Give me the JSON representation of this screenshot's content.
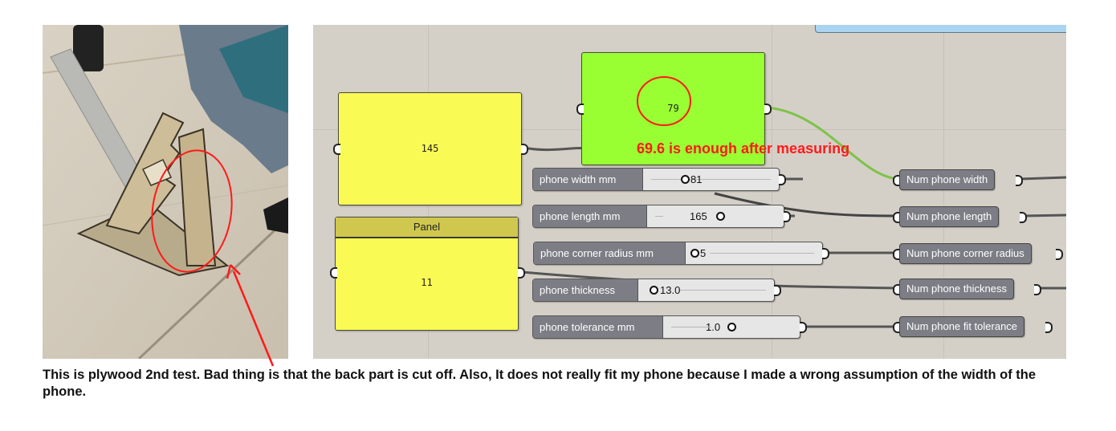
{
  "photo": {
    "description_icon": "plywood-phone-stand-photo-icon"
  },
  "canvas": {
    "panels": {
      "width_panel_value": "145",
      "result_panel_value": "79",
      "thickness_panel_title": "Panel",
      "thickness_panel_value": "11"
    },
    "sliders": [
      {
        "label": "phone width mm",
        "value": "81",
        "fraction": 0.48
      },
      {
        "label": "phone length mm",
        "value": "165",
        "fraction": 0.5
      },
      {
        "label": "phone corner radius mm",
        "value": "5",
        "fraction": 0.05
      },
      {
        "label": "phone thickness",
        "value": "13.0",
        "fraction": 0.1
      },
      {
        "label": "phone tolerance mm",
        "value": "1.0",
        "fraction": 0.5
      }
    ],
    "num_params": [
      {
        "label": "Num phone width"
      },
      {
        "label": "Num phone length"
      },
      {
        "label": "Num phone corner radius"
      },
      {
        "label": "Num phone thickness"
      },
      {
        "label": "Num phone fit tolerance"
      }
    ],
    "annotation": "69.6 is enough after measuring"
  },
  "caption": "This is plywood 2nd test. Bad thing is that the back part is cut off. Also, It does not really fit my phone because I made a wrong assumption of the width of the phone.",
  "colors": {
    "annotation_red": "#ff1a1a",
    "panel_yellow": "#fafa55",
    "panel_green": "#99ff33",
    "canvas_bg": "#d4d0c8"
  }
}
